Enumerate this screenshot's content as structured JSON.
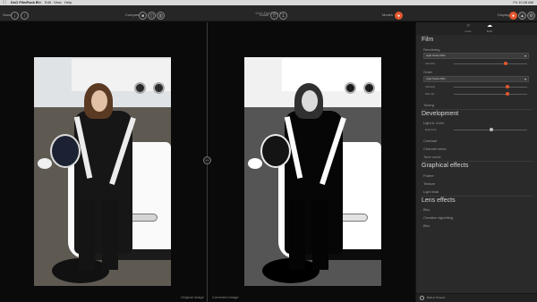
{
  "menubar": {
    "apple": "",
    "items": [
      "DxO FilmPack 5",
      "File",
      "Edit",
      "View",
      "Help"
    ],
    "clock": "Fri 10:28 AM"
  },
  "window": {
    "title": "DxO FilmPack 5"
  },
  "toolbar": {
    "save_label": "Save",
    "compare_label": "Compare",
    "zoom_label": "Zoom",
    "modes_label": "Modes",
    "display_label": "Display"
  },
  "viewer": {
    "left_label": "Original image",
    "right_label": "Corrected image",
    "split_icon": "split-arrows-icon"
  },
  "panel": {
    "tabs": [
      {
        "label": "Color",
        "icon": "color-icon"
      },
      {
        "label": "Both",
        "icon": "both-icon"
      }
    ],
    "sections": {
      "film": {
        "title": "Film",
        "rendering_label": "Rendering",
        "rendering_value": "Agfa Scala 200x",
        "intensity_label": "Intensity",
        "intensity": 0.7,
        "grain_label": "Grain",
        "grain_value": "Agfa Scala 200x",
        "grain_intensity_label": "Intensity",
        "grain_intensity": 0.72,
        "grain_size_label": "Size (0)",
        "grain_size": 0.72,
        "toning_label": "Toning"
      },
      "development": {
        "title": "Development",
        "light_color_label": "Light & Color",
        "exposure_label": "Exposure",
        "exposure": 0.5,
        "contrast_label": "Contrast",
        "channel_mixer_label": "Channel mixer",
        "tone_curve_label": "Tone curve"
      },
      "graphical": {
        "title": "Graphical effects",
        "frame_label": "Frame",
        "texture_label": "Texture",
        "light_leak_label": "Light leak"
      },
      "lens": {
        "title": "Lens effects",
        "blur_label": "Blur",
        "creative_vignetting_label": "Creative vignetting",
        "blur2_label": "Blur"
      }
    },
    "footer": "Built-in Presets"
  },
  "colors": {
    "accent": "#e4572e",
    "panel": "#2a2a2a"
  }
}
